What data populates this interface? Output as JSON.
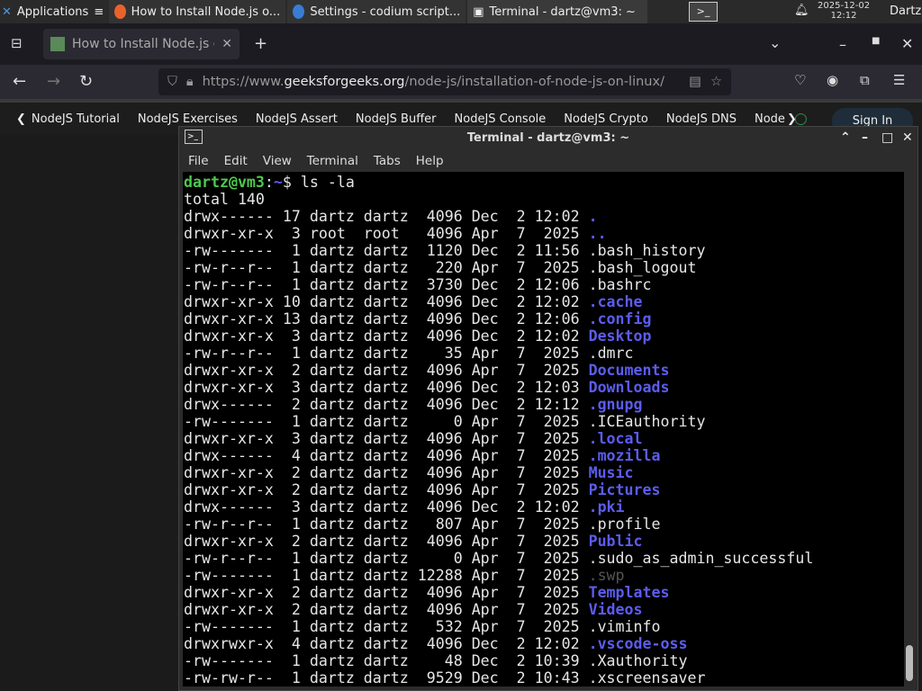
{
  "panel": {
    "apps_label": "Applications",
    "tasks": [
      "How to Install Node.js o...",
      "Settings - codium script...",
      "Terminal - dartz@vm3: ~"
    ],
    "date": "2025-12-02",
    "time": "12:12",
    "user": "Dartz"
  },
  "browser": {
    "tab_title": "How to Install Node.js on",
    "url_prefix": "https://www.",
    "url_domain": "geeksforgeeks.org",
    "url_path": "/node-js/installation-of-node-js-on-linux/",
    "site_nav": [
      "NodeJS Tutorial",
      "NodeJS Exercises",
      "NodeJS Assert",
      "NodeJS Buffer",
      "NodeJS Console",
      "NodeJS Crypto",
      "NodeJS DNS",
      "Node"
    ],
    "sign_in": "Sign In"
  },
  "terminal": {
    "title": "Terminal - dartz@vm3: ~",
    "menu": [
      "File",
      "Edit",
      "View",
      "Terminal",
      "Tabs",
      "Help"
    ],
    "prompt_user": "dartz@vm3",
    "prompt_path": "~",
    "command": "ls -la",
    "total": "total 140",
    "lines": [
      [
        "drwx------ 17 dartz dartz  4096 Dec  2 12:02 ",
        ".",
        "dir"
      ],
      [
        "drwxr-xr-x  3 root  root   4096 Apr  7  2025 ",
        "..",
        "dir"
      ],
      [
        "-rw-------  1 dartz dartz  1120 Dec  2 11:56 ",
        ".bash_history",
        "file"
      ],
      [
        "-rw-r--r--  1 dartz dartz   220 Apr  7  2025 ",
        ".bash_logout",
        "file"
      ],
      [
        "-rw-r--r--  1 dartz dartz  3730 Dec  2 12:06 ",
        ".bashrc",
        "file"
      ],
      [
        "drwxr-xr-x 10 dartz dartz  4096 Dec  2 12:02 ",
        ".cache",
        "dir"
      ],
      [
        "drwxr-xr-x 13 dartz dartz  4096 Dec  2 12:06 ",
        ".config",
        "dir"
      ],
      [
        "drwxr-xr-x  3 dartz dartz  4096 Dec  2 12:02 ",
        "Desktop",
        "dir"
      ],
      [
        "-rw-r--r--  1 dartz dartz    35 Apr  7  2025 ",
        ".dmrc",
        "file"
      ],
      [
        "drwxr-xr-x  2 dartz dartz  4096 Apr  7  2025 ",
        "Documents",
        "dir"
      ],
      [
        "drwxr-xr-x  3 dartz dartz  4096 Dec  2 12:03 ",
        "Downloads",
        "dir"
      ],
      [
        "drwx------  2 dartz dartz  4096 Dec  2 12:12 ",
        ".gnupg",
        "dir"
      ],
      [
        "-rw-------  1 dartz dartz     0 Apr  7  2025 ",
        ".ICEauthority",
        "file"
      ],
      [
        "drwxr-xr-x  3 dartz dartz  4096 Apr  7  2025 ",
        ".local",
        "dir"
      ],
      [
        "drwx------  4 dartz dartz  4096 Apr  7  2025 ",
        ".mozilla",
        "dir"
      ],
      [
        "drwxr-xr-x  2 dartz dartz  4096 Apr  7  2025 ",
        "Music",
        "dir"
      ],
      [
        "drwxr-xr-x  2 dartz dartz  4096 Apr  7  2025 ",
        "Pictures",
        "dir"
      ],
      [
        "drwx------  3 dartz dartz  4096 Dec  2 12:02 ",
        ".pki",
        "dir"
      ],
      [
        "-rw-r--r--  1 dartz dartz   807 Apr  7  2025 ",
        ".profile",
        "file"
      ],
      [
        "drwxr-xr-x  2 dartz dartz  4096 Apr  7  2025 ",
        "Public",
        "dir"
      ],
      [
        "-rw-r--r--  1 dartz dartz     0 Apr  7  2025 ",
        ".sudo_as_admin_successful",
        "file"
      ],
      [
        "-rw-------  1 dartz dartz 12288 Apr  7  2025 ",
        ".swp",
        "dim"
      ],
      [
        "drwxr-xr-x  2 dartz dartz  4096 Apr  7  2025 ",
        "Templates",
        "dir"
      ],
      [
        "drwxr-xr-x  2 dartz dartz  4096 Apr  7  2025 ",
        "Videos",
        "dir"
      ],
      [
        "-rw-------  1 dartz dartz   532 Apr  7  2025 ",
        ".viminfo",
        "file"
      ],
      [
        "drwxrwxr-x  4 dartz dartz  4096 Dec  2 12:02 ",
        ".vscode-oss",
        "dir"
      ],
      [
        "-rw-------  1 dartz dartz    48 Dec  2 10:39 ",
        ".Xauthority",
        "file"
      ],
      [
        "-rw-rw-r--  1 dartz dartz  9529 Dec  2 10:43 ",
        ".xscreensaver",
        "file"
      ]
    ]
  },
  "colors": {
    "directory": "#5c5cf0",
    "prompt": "#4cc94c",
    "background": "#000000"
  }
}
